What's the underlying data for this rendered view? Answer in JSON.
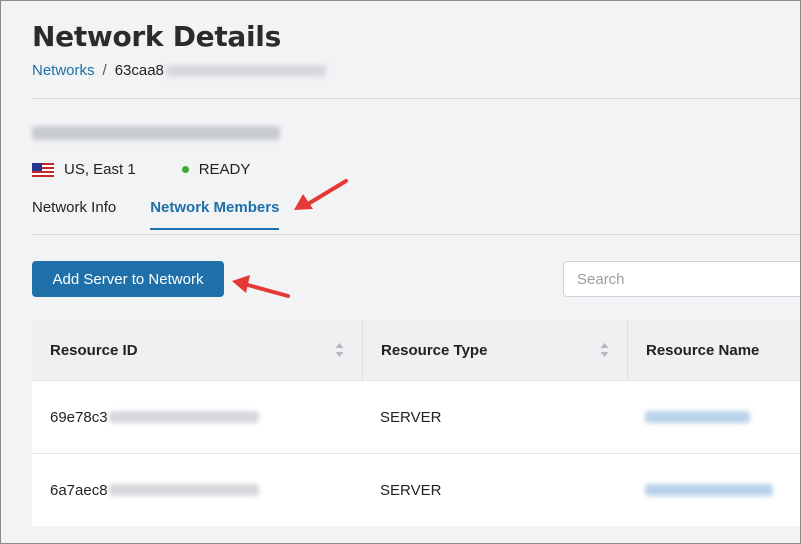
{
  "page": {
    "title": "Network Details"
  },
  "breadcrumb": {
    "parent": "Networks",
    "separator": "/",
    "current": "63caa8"
  },
  "network": {
    "region": "US, East 1",
    "status": "READY",
    "status_color": "#3aaa35"
  },
  "tabs": [
    {
      "label": "Network Info",
      "active": false
    },
    {
      "label": "Network Members",
      "active": true
    }
  ],
  "actions": {
    "add_server_label": "Add Server to Network"
  },
  "search": {
    "placeholder": "Search",
    "value": ""
  },
  "table": {
    "columns": [
      "Resource ID",
      "Resource Type",
      "Resource Name"
    ],
    "rows": [
      {
        "resource_id": "69e78c3",
        "resource_type": "SERVER"
      },
      {
        "resource_id": "6a7aec8",
        "resource_type": "SERVER"
      }
    ]
  },
  "colors": {
    "accent": "#1f6fa8",
    "annotation_arrow": "#e53935"
  },
  "icons": {
    "flag": "us-flag-icon",
    "sort": "sort-icon",
    "arrow": "annotation-arrow-icon"
  }
}
